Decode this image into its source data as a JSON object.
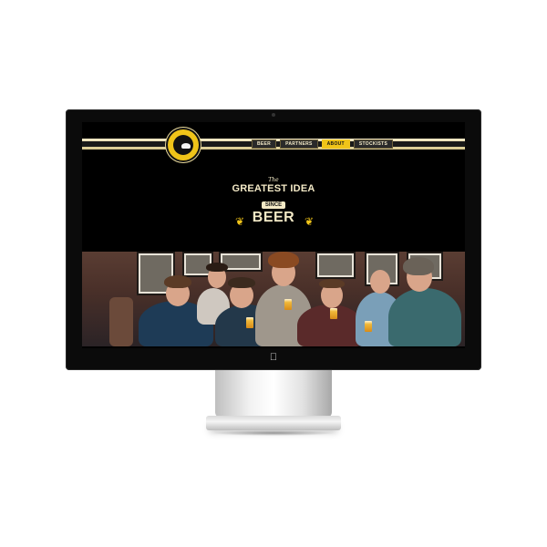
{
  "website": {
    "nav": {
      "items": [
        {
          "label": "BEER",
          "active": false
        },
        {
          "label": "PARTNERS",
          "active": false
        },
        {
          "label": "ABOUT",
          "active": true
        },
        {
          "label": "STOCKISTS",
          "active": false
        }
      ]
    },
    "hero": {
      "the": "The",
      "line1": "GREATEST IDEA",
      "line2": "SINCE",
      "line3": "BEER"
    }
  },
  "colors": {
    "accent": "#f0c419",
    "cream": "#f3e9c6",
    "background": "#000000"
  },
  "icons": {
    "chin_logo": "apple-logo-icon",
    "site_logo": "brand-logo-icon",
    "wheat": "wheat-icon"
  }
}
